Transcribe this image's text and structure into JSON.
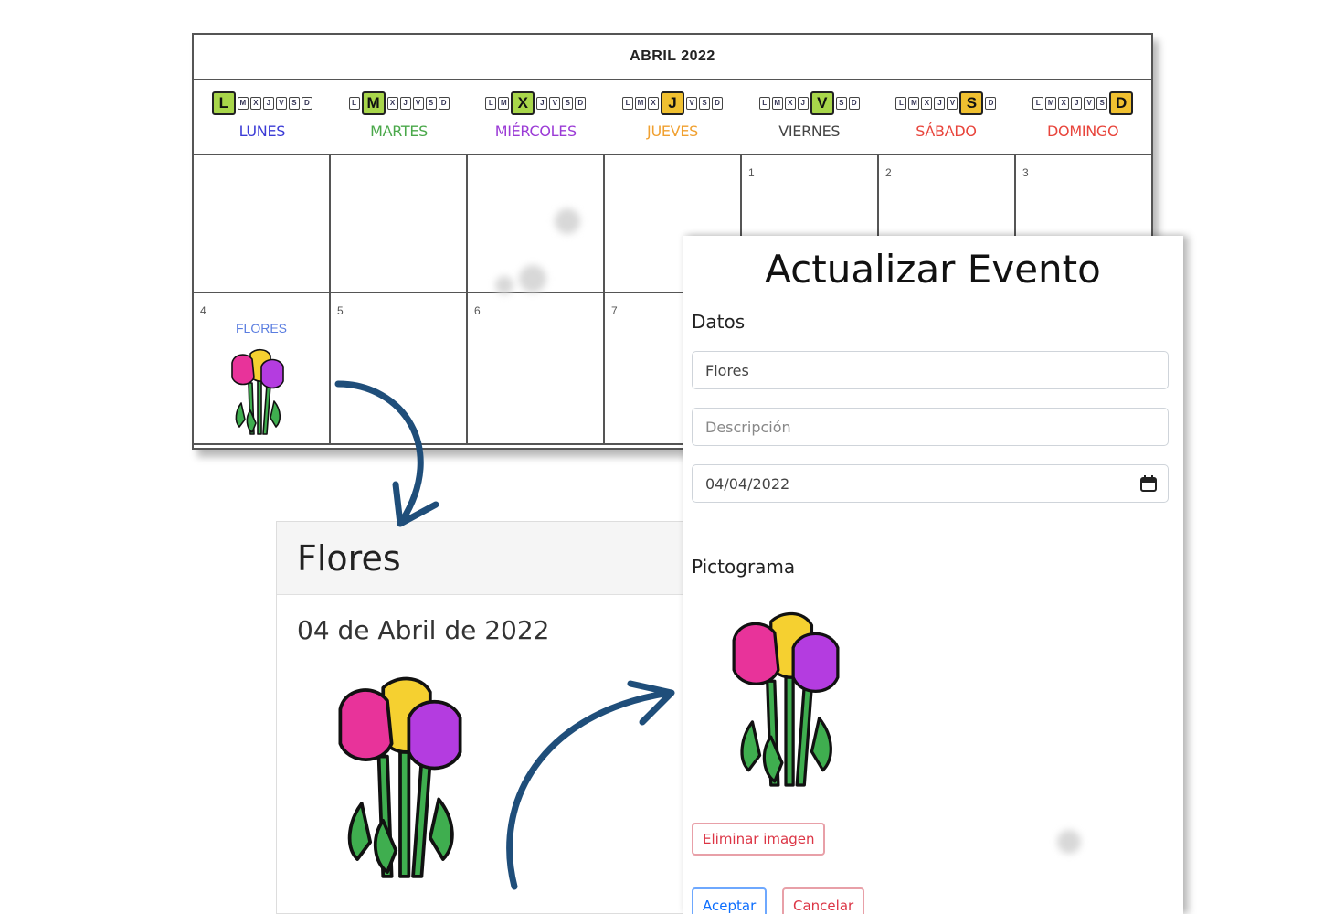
{
  "calendar": {
    "title": "ABRIL 2022",
    "weekdays": [
      {
        "letter": "L",
        "label": "LUNES",
        "color": "#3b3bd6",
        "hl_color": "#a8d64a",
        "hl_index": 0
      },
      {
        "letter": "M",
        "label": "MARTES",
        "color": "#4aa84a",
        "hl_color": "#a8d64a",
        "hl_index": 1
      },
      {
        "letter": "X",
        "label": "MIÉRCOLES",
        "color": "#9b3bd6",
        "hl_color": "#a8d64a",
        "hl_index": 2
      },
      {
        "letter": "J",
        "label": "JUEVES",
        "color": "#f0a030",
        "hl_color": "#f0c030",
        "hl_index": 3
      },
      {
        "letter": "V",
        "label": "VIERNES",
        "color": "#444444",
        "hl_color": "#a8d64a",
        "hl_index": 4
      },
      {
        "letter": "S",
        "label": "SÁBADO",
        "color": "#e8453c",
        "hl_color": "#f0c030",
        "hl_index": 5
      },
      {
        "letter": "D",
        "label": "DOMINGO",
        "color": "#e8453c",
        "hl_color": "#f0c030",
        "hl_index": 6
      }
    ],
    "strip_letters": [
      "L",
      "M",
      "X",
      "J",
      "V",
      "S",
      "D"
    ],
    "week1": [
      "",
      "",
      "",
      "",
      "1",
      "2",
      "3"
    ],
    "week2": [
      "4",
      "5",
      "6",
      "7",
      "",
      "",
      ""
    ],
    "event": {
      "name": "FLORES",
      "day": "4"
    }
  },
  "card": {
    "title": "Flores",
    "date": "04 de Abril de 2022"
  },
  "modal": {
    "title": "Actualizar Evento",
    "datos_heading": "Datos",
    "name_value": "Flores",
    "description_placeholder": "Descripción",
    "date_value": "04/04/2022",
    "pictograma_heading": "Pictograma",
    "remove_image_label": "Eliminar imagen",
    "accept_label": "Aceptar",
    "cancel_label": "Cancelar"
  },
  "colors": {
    "arrow": "#1f4e7a",
    "tulip_pink": "#e8339a",
    "tulip_yellow": "#f5d030",
    "tulip_purple": "#b43ce0",
    "stem": "#3fae4f"
  }
}
